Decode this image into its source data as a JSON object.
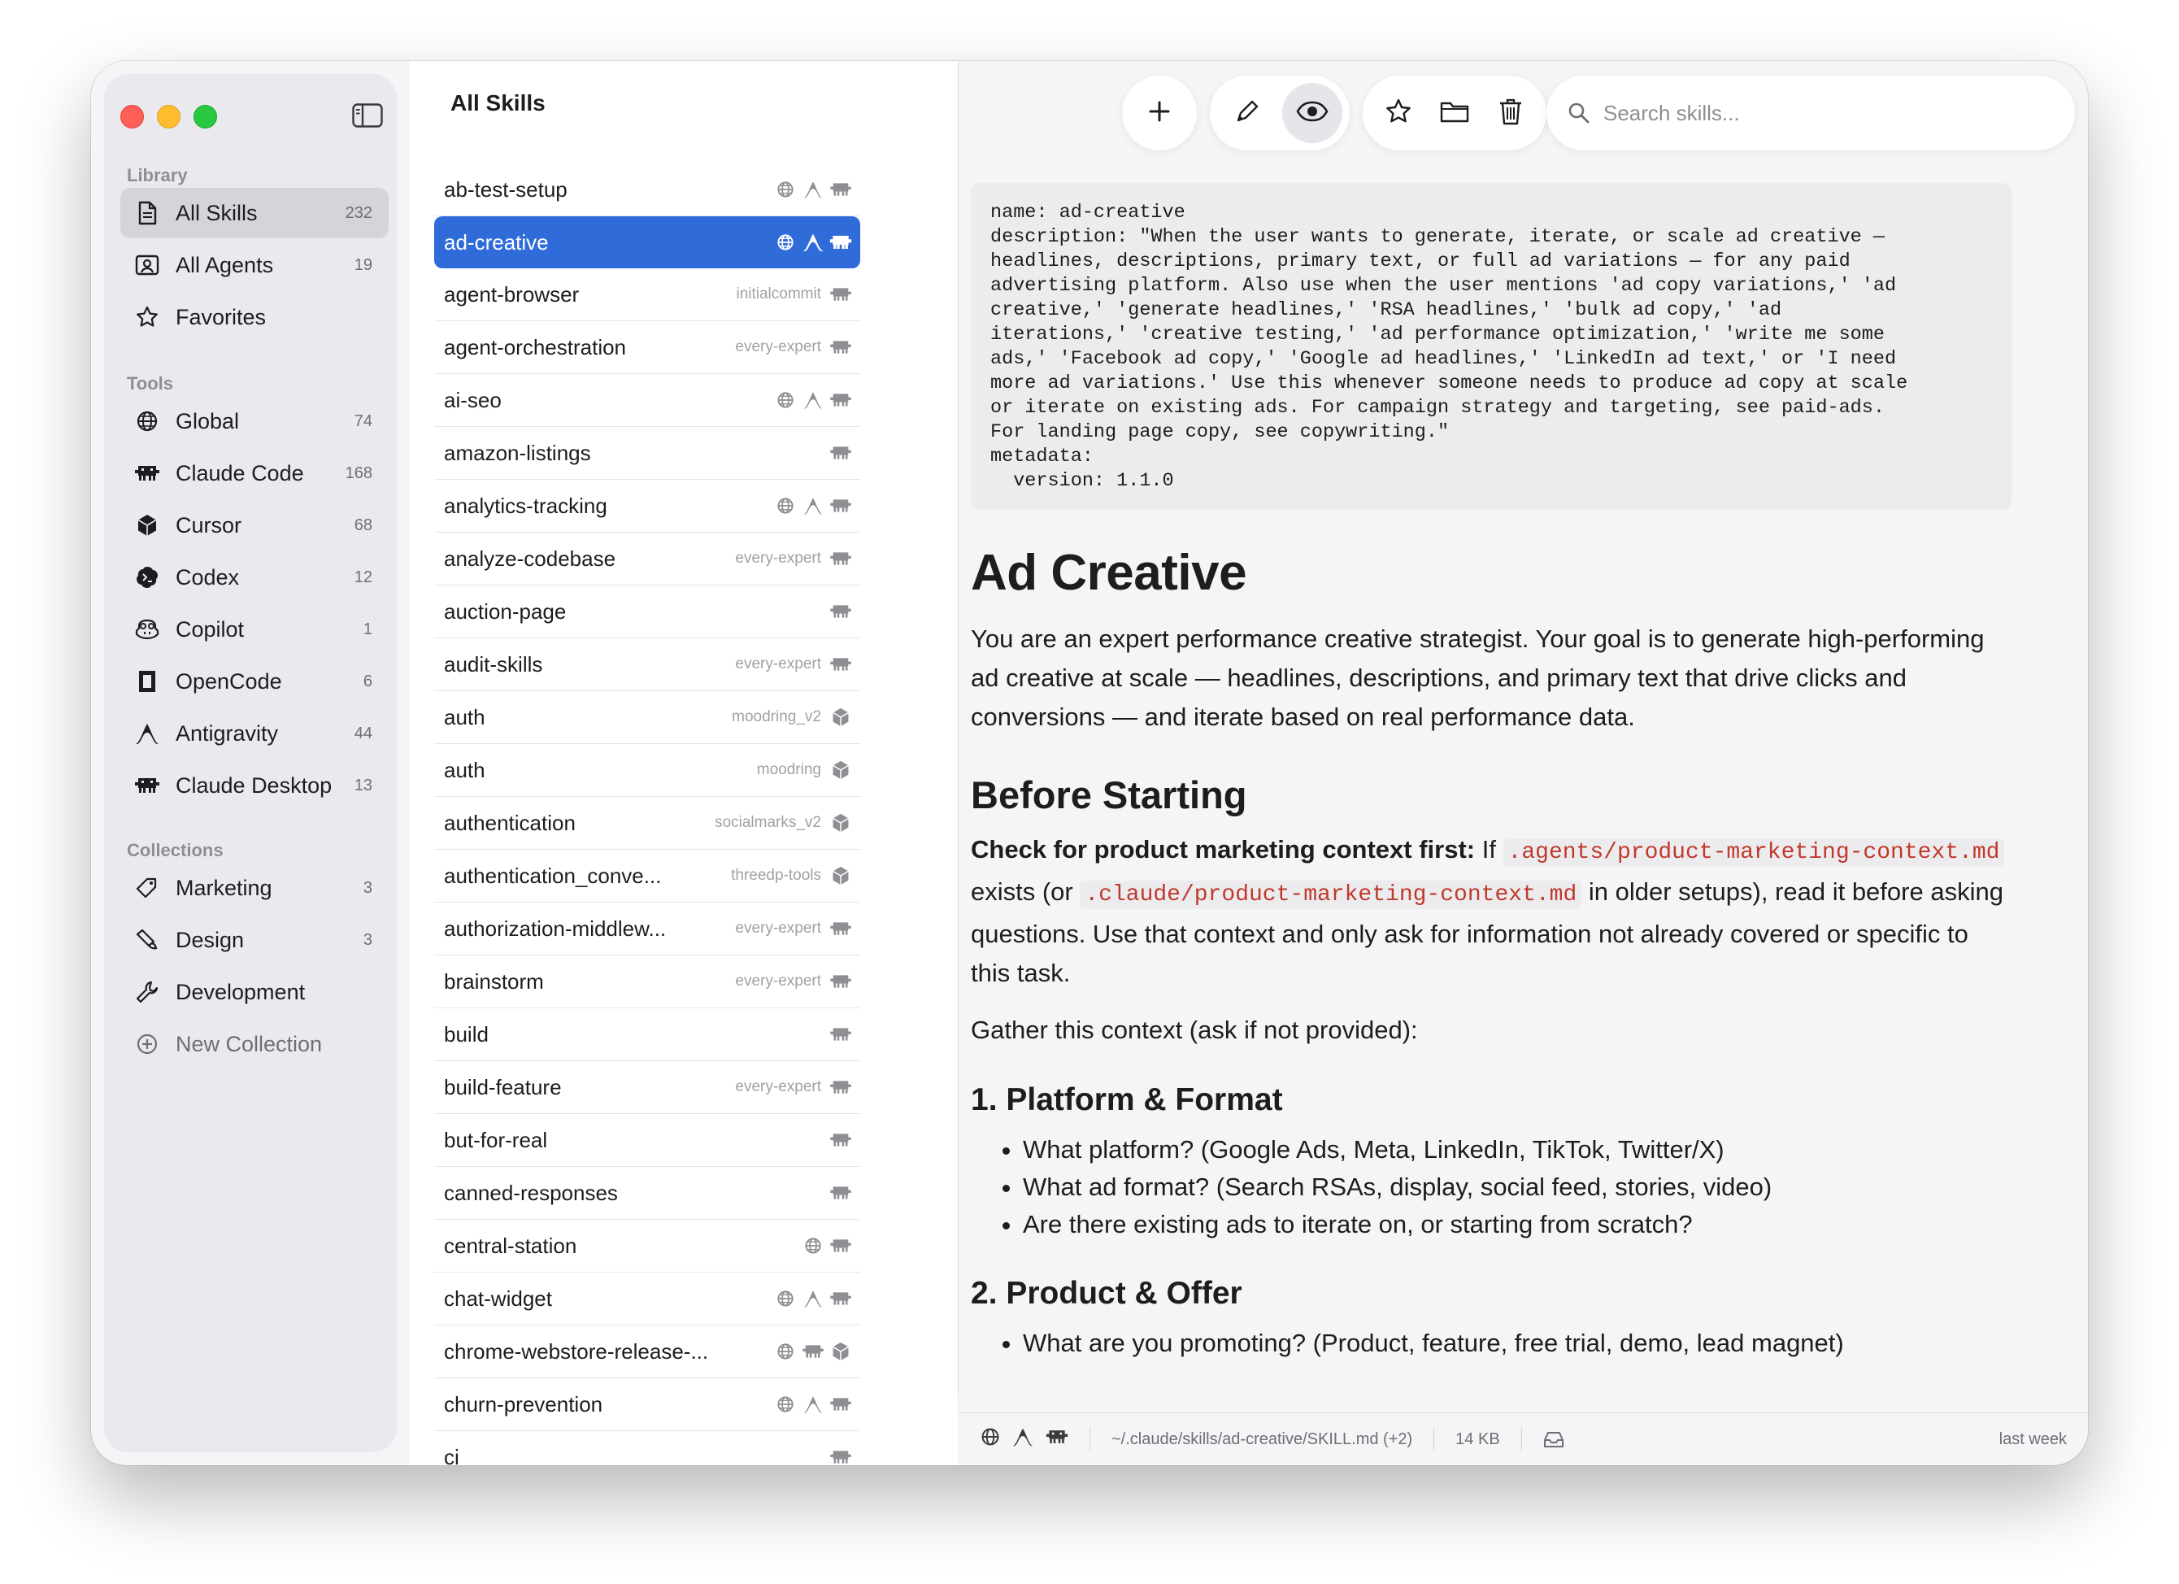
{
  "sidebar": {
    "library_label": "Library",
    "library": [
      {
        "label": "All Skills",
        "count": "232"
      },
      {
        "label": "All Agents",
        "count": "19"
      },
      {
        "label": "Favorites",
        "count": ""
      }
    ],
    "tools_label": "Tools",
    "tools": [
      {
        "label": "Global",
        "count": "74"
      },
      {
        "label": "Claude Code",
        "count": "168"
      },
      {
        "label": "Cursor",
        "count": "68"
      },
      {
        "label": "Codex",
        "count": "12"
      },
      {
        "label": "Copilot",
        "count": "1"
      },
      {
        "label": "OpenCode",
        "count": "6"
      },
      {
        "label": "Antigravity",
        "count": "44"
      },
      {
        "label": "Claude Desktop",
        "count": "13"
      }
    ],
    "collections_label": "Collections",
    "collections": [
      {
        "label": "Marketing",
        "count": "3"
      },
      {
        "label": "Design",
        "count": "3"
      },
      {
        "label": "Development",
        "count": ""
      }
    ],
    "new_collection": "New Collection"
  },
  "list": {
    "title": "All Skills",
    "items": [
      {
        "name": "ab-test-setup",
        "project": "",
        "icons": [
          "globe-icon",
          "antigravity-icon",
          "claude-code-icon"
        ]
      },
      {
        "name": "ad-creative",
        "project": "",
        "icons": [
          "globe-icon",
          "antigravity-icon",
          "claude-code-icon"
        ]
      },
      {
        "name": "agent-browser",
        "project": "initialcommit",
        "icons": [
          "claude-code-icon"
        ]
      },
      {
        "name": "agent-orchestration",
        "project": "every-expert",
        "icons": [
          "claude-code-icon"
        ]
      },
      {
        "name": "ai-seo",
        "project": "",
        "icons": [
          "globe-icon",
          "antigravity-icon",
          "claude-code-icon"
        ]
      },
      {
        "name": "amazon-listings",
        "project": "",
        "icons": [
          "claude-code-icon"
        ]
      },
      {
        "name": "analytics-tracking",
        "project": "",
        "icons": [
          "globe-icon",
          "antigravity-icon",
          "claude-code-icon"
        ]
      },
      {
        "name": "analyze-codebase",
        "project": "every-expert",
        "icons": [
          "claude-code-icon"
        ]
      },
      {
        "name": "auction-page",
        "project": "",
        "icons": [
          "claude-code-icon"
        ]
      },
      {
        "name": "audit-skills",
        "project": "every-expert",
        "icons": [
          "claude-code-icon"
        ]
      },
      {
        "name": "auth",
        "project": "moodring_v2",
        "icons": [
          "cursor-icon"
        ]
      },
      {
        "name": "auth",
        "project": "moodring",
        "icons": [
          "cursor-icon"
        ]
      },
      {
        "name": "authentication",
        "project": "socialmarks_v2",
        "icons": [
          "cursor-icon"
        ]
      },
      {
        "name": "authentication_conve...",
        "project": "threedp-tools",
        "icons": [
          "cursor-icon"
        ]
      },
      {
        "name": "authorization-middlew...",
        "project": "every-expert",
        "icons": [
          "claude-code-icon"
        ]
      },
      {
        "name": "brainstorm",
        "project": "every-expert",
        "icons": [
          "claude-code-icon"
        ]
      },
      {
        "name": "build",
        "project": "",
        "icons": [
          "claude-code-icon"
        ]
      },
      {
        "name": "build-feature",
        "project": "every-expert",
        "icons": [
          "claude-code-icon"
        ]
      },
      {
        "name": "but-for-real",
        "project": "",
        "icons": [
          "claude-code-icon"
        ]
      },
      {
        "name": "canned-responses",
        "project": "",
        "icons": [
          "claude-code-icon"
        ]
      },
      {
        "name": "central-station",
        "project": "",
        "icons": [
          "globe-icon",
          "claude-code-icon"
        ]
      },
      {
        "name": "chat-widget",
        "project": "",
        "icons": [
          "globe-icon",
          "antigravity-icon",
          "claude-code-icon"
        ]
      },
      {
        "name": "chrome-webstore-release-...",
        "project": "",
        "icons": [
          "globe-icon",
          "claude-code-icon",
          "cursor-icon"
        ]
      },
      {
        "name": "churn-prevention",
        "project": "",
        "icons": [
          "globe-icon",
          "antigravity-icon",
          "claude-code-icon"
        ]
      },
      {
        "name": "ci",
        "project": "",
        "icons": [
          "claude-code-icon"
        ]
      }
    ]
  },
  "toolbar": {
    "search_placeholder": "Search skills..."
  },
  "doc": {
    "frontmatter": "name: ad-creative\ndescription: \"When the user wants to generate, iterate, or scale ad creative —\nheadlines, descriptions, primary text, or full ad variations — for any paid\nadvertising platform. Also use when the user mentions 'ad copy variations,' 'ad\ncreative,' 'generate headlines,' 'RSA headlines,' 'bulk ad copy,' 'ad\niterations,' 'creative testing,' 'ad performance optimization,' 'write me some\nads,' 'Facebook ad copy,' 'Google ad headlines,' 'LinkedIn ad text,' or 'I need\nmore ad variations.' Use this whenever someone needs to produce ad copy at scale\nor iterate on existing ads. For campaign strategy and targeting, see paid-ads.\nFor landing page copy, see copywriting.\"\nmetadata:\n  version: 1.1.0",
    "title": "Ad Creative",
    "intro": "You are an expert performance creative strategist. Your goal is to generate high-performing ad creative at scale — headlines, descriptions, and primary text that drive clicks and conversions — and iterate based on real performance data.",
    "h_before": "Before Starting",
    "check_bold": "Check for product marketing context first:",
    "check_if": " If ",
    "check_code1": ".agents/product-marketing-context.md",
    "check_mid": " exists (or ",
    "check_code2": ".claude/product-marketing-context.md",
    "check_end": " in older setups), read it before asking questions. Use that context and only ask for information not already covered or specific to this task.",
    "gather": "Gather this context (ask if not provided):",
    "h_platform": "1. Platform & Format",
    "platform_items": [
      "What platform? (Google Ads, Meta, LinkedIn, TikTok, Twitter/X)",
      "What ad format? (Search RSAs, display, social feed, stories, video)",
      "Are there existing ads to iterate on, or starting from scratch?"
    ],
    "h_product": "2. Product & Offer",
    "product_items": [
      "What are you promoting? (Product, feature, free trial, demo, lead magnet)"
    ]
  },
  "status": {
    "path": "~/.claude/skills/ad-creative/SKILL.md (+2)",
    "size": "14 KB",
    "modified": "last week"
  },
  "colors": {
    "accent": "#2f6bd9",
    "code_text": "#c0392b"
  }
}
